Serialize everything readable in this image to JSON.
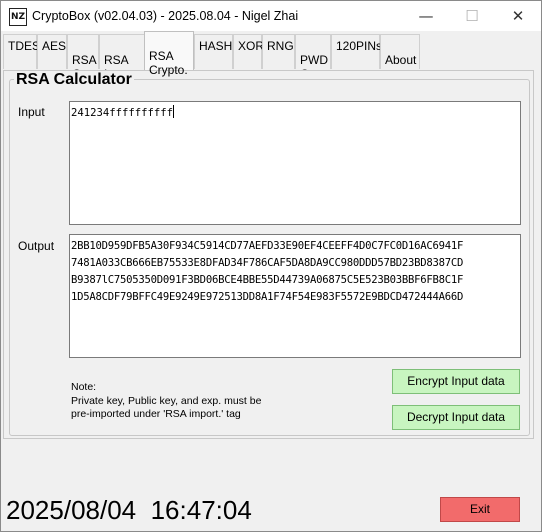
{
  "window": {
    "title": "CryptoBox (v02.04.03) - 2025.08.04 - Nigel Zhai",
    "icon_text": "NZ",
    "minimize_glyph": "—",
    "maximize_glyph": "☐",
    "close_glyph": "✕"
  },
  "tabs": [
    {
      "label": "TDES"
    },
    {
      "label": "AES"
    },
    {
      "label": "RSA\nGen."
    },
    {
      "label": "RSA\nImport."
    },
    {
      "label": "RSA\nCrypto.",
      "active": true
    },
    {
      "label": "HASH"
    },
    {
      "label": "XOR"
    },
    {
      "label": "RNG"
    },
    {
      "label": "PWD\nGen"
    },
    {
      "label": "120PINs"
    },
    {
      "label": "About\n..."
    }
  ],
  "rsa": {
    "group_title": "RSA Calculator",
    "input_label": "Input",
    "input_value": "241234ffffffffff",
    "output_label": "Output",
    "output_lines": [
      "2BB10D959DFB5A30F934C5914CD77AEFD33E90EF4CEEFF4D0C7FC0D16AC6941F",
      "7481A033CB666EB75533E8DFAD34F786CAF5DA8DA9CC980DDD57BD23BD8387CD",
      "B9387lC7505350D091F3BD06BCE4BBE55D44739A06875C5E523B03BBF6FB8C1F",
      "1D5A8CDF79BFFC49E9249E972513DD8A1F74F54E983F5572E9BDCD472444A66D"
    ],
    "note_lines": [
      "Note:",
      "Private key, Public key, and exp. must be",
      "pre-imported under 'RSA import.' tag"
    ],
    "encrypt_label": "Encrypt Input data",
    "decrypt_label": "Decrypt Input data"
  },
  "footer": {
    "date": "2025/08/04",
    "time": "16:47:04",
    "exit_label": "Exit"
  },
  "colors": {
    "action_button": "#c8f5c0",
    "exit_button": "#f26b6b"
  }
}
